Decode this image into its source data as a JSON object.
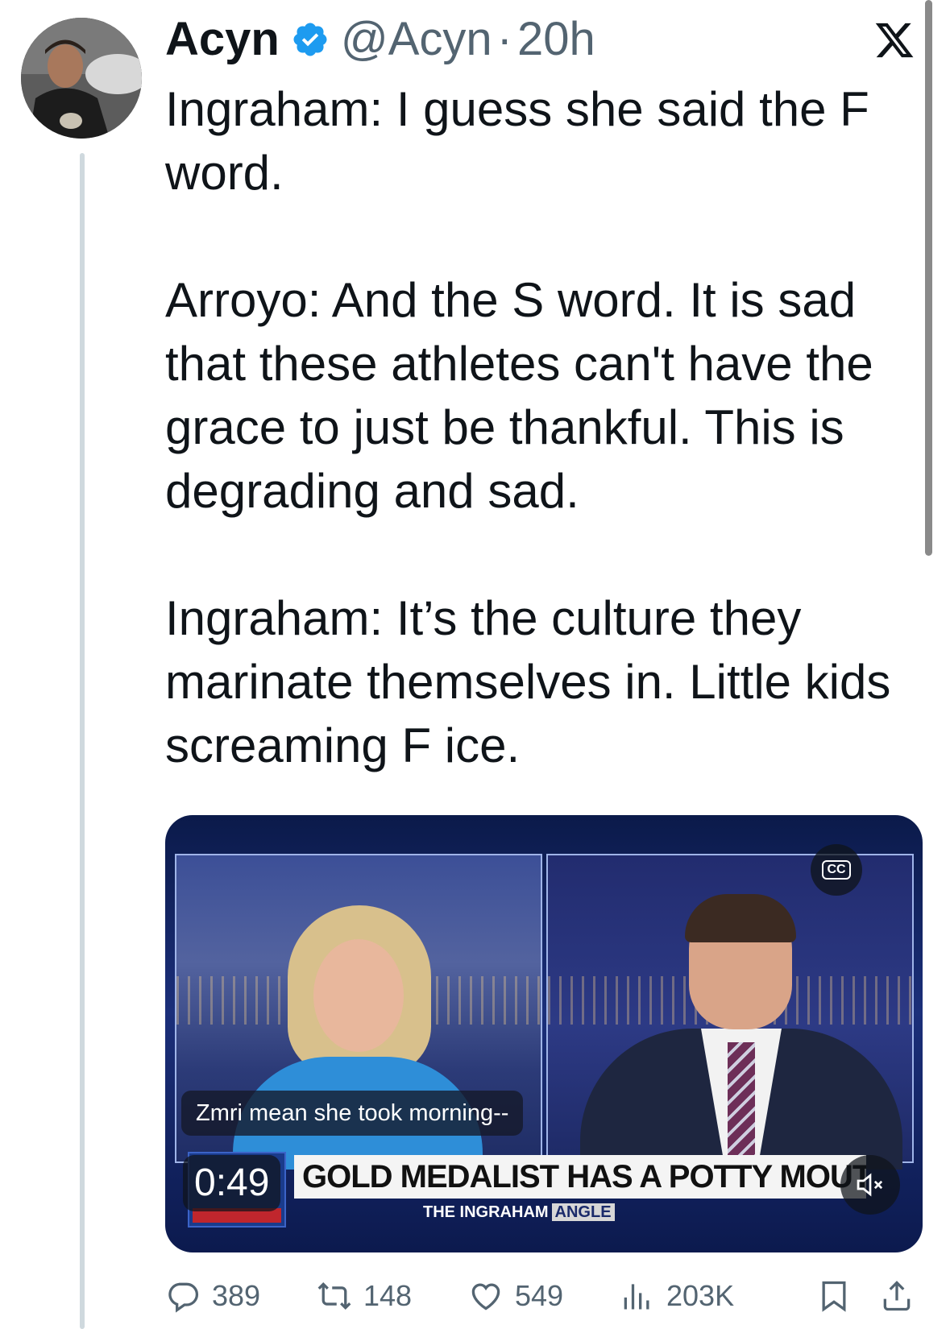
{
  "tweet": {
    "author_name": "Acyn",
    "handle": "@Acyn",
    "separator": "·",
    "time": "20h",
    "paragraphs": [
      "Ingraham: I guess she said the F word.",
      "Arroyo: And the S word. It is sad that these athletes can't have the grace to just be thankful. This is degrading and sad.",
      "Ingraham: It’s the culture they marinate themselves in. Little kids screaming F ice."
    ]
  },
  "video": {
    "caption": "Zmri mean she took morning--",
    "duration": "0:49",
    "cc_label": "CC",
    "chyron": "GOLD MEDALIST HAS A POTTY MOUTH",
    "show_name_left": "THE INGRAHAM",
    "show_name_right": "ANGLE"
  },
  "actions": {
    "replies": "389",
    "reposts": "148",
    "likes": "549",
    "views": "203K"
  },
  "colors": {
    "text_primary": "#0f1419",
    "text_secondary": "#536471",
    "verified_blue": "#1d9bf0",
    "thread_line": "#cfd9de"
  },
  "icons": [
    "verified-badge-icon",
    "x-logo-icon",
    "cc-icon",
    "mute-icon",
    "reply-icon",
    "repost-icon",
    "like-icon",
    "views-icon",
    "bookmark-icon",
    "share-icon"
  ]
}
